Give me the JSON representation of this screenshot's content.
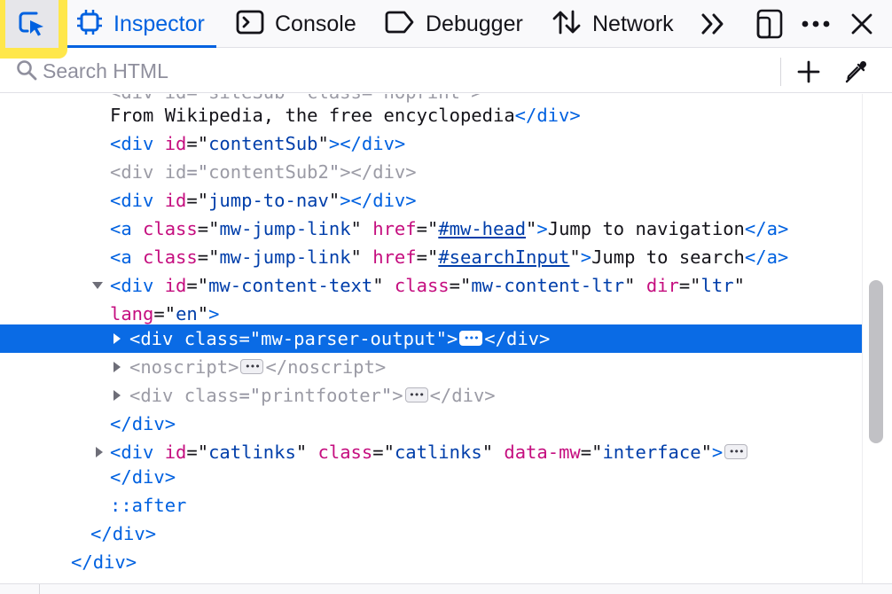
{
  "toolbar": {
    "picker": {
      "icon": "element-picker-icon",
      "highlight_color": "#ffe74a"
    },
    "tabs": [
      {
        "label": "Inspector",
        "icon": "inspector-frame-icon",
        "selected": true
      },
      {
        "label": "Console",
        "icon": "console-prompt-icon",
        "selected": false
      },
      {
        "label": "Debugger",
        "icon": "debugger-tag-icon",
        "selected": false
      },
      {
        "label": "Network",
        "icon": "network-arrows-icon",
        "selected": false
      }
    ],
    "overflow_icon": "chevron-double-right-icon",
    "responsive_icon": "responsive-design-icon",
    "menu_icon": "more-horizontal-icon",
    "close_icon": "close-icon",
    "accent_color": "#0061e0"
  },
  "search": {
    "placeholder": "Search HTML",
    "value": "",
    "add_node_icon": "plus-icon",
    "eyedropper_icon": "eyedropper-icon"
  },
  "tree": {
    "partial_top_line": "<div id=\"siteSub\" class=\"noprint\">",
    "line1_text": "From Wikipedia, the free encyclopedia",
    "div": "div",
    "a": "a",
    "noscript": "noscript",
    "attr_id": "id",
    "attr_class": "class",
    "attr_href": "href",
    "attr_dir": "dir",
    "attr_lang": "lang",
    "attr_data_mw": "data-mw",
    "contentSub": "contentSub",
    "contentSub2": "contentSub2",
    "jump_to_nav": "jump-to-nav",
    "mw_jump_link": "mw-jump-link",
    "href_head": "#mw-head",
    "jump_nav_text": "Jump to navigation",
    "href_search": "#searchInput",
    "jump_search_text": "Jump to search",
    "mw_content_text": "mw-content-text",
    "mw_content_ltr": "mw-content-ltr",
    "ltr": "ltr",
    "en": "en",
    "mw_parser_output": "mw-parser-output",
    "printfooter": "printfooter",
    "catlinks": "catlinks",
    "interface": "interface",
    "after_pseudo": "::after",
    "selected_row_color": "#0a6be5"
  }
}
